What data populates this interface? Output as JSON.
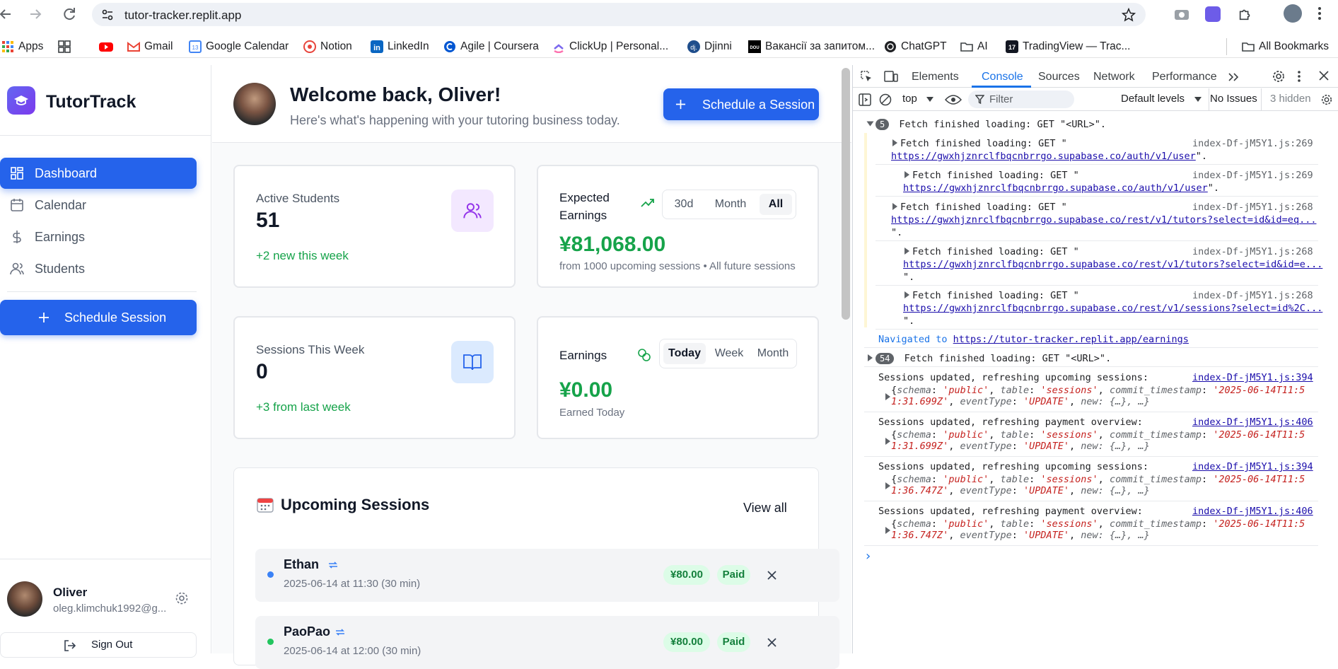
{
  "browser": {
    "url": "tutor-tracker.replit.app",
    "bookmarks": [
      {
        "label": "Apps",
        "icon": "apps-grid-icon"
      },
      {
        "label": "",
        "icon": "tab-groups-icon"
      },
      {
        "label": "",
        "icon": "youtube-icon"
      },
      {
        "label": "Gmail",
        "icon": "gmail-icon"
      },
      {
        "label": "Google Calendar",
        "icon": "google-calendar-icon"
      },
      {
        "label": "Notion",
        "icon": "notion-icon"
      },
      {
        "label": "LinkedIn",
        "icon": "linkedin-icon"
      },
      {
        "label": "Agile | Coursera",
        "icon": "coursera-icon"
      },
      {
        "label": "ClickUp | Personal...",
        "icon": "clickup-icon"
      },
      {
        "label": "Djinni",
        "icon": "djinni-icon"
      },
      {
        "label": "Вакансії за запитом...",
        "icon": "dou-icon"
      },
      {
        "label": "ChatGPT",
        "icon": "chatgpt-icon"
      },
      {
        "label": "AI",
        "icon": "folder-icon"
      },
      {
        "label": "TradingView — Trac...",
        "icon": "tradingview-icon"
      }
    ],
    "all_bookmarks": "All Bookmarks"
  },
  "sidebar": {
    "app_name": "TutorTrack",
    "nav": [
      {
        "label": "Dashboard",
        "icon": "dashboard-icon",
        "active": true
      },
      {
        "label": "Calendar",
        "icon": "calendar-icon",
        "active": false
      },
      {
        "label": "Earnings",
        "icon": "dollar-icon",
        "active": false
      },
      {
        "label": "Students",
        "icon": "users-icon",
        "active": false
      }
    ],
    "schedule_button": "Schedule Session",
    "user": {
      "name": "Oliver",
      "email": "oleg.klimchuk1992@g..."
    },
    "sign_out": "Sign Out"
  },
  "header": {
    "welcome": "Welcome back, Oliver!",
    "subtitle": "Here's what's happening with your tutoring business today.",
    "schedule_button": "Schedule a Session"
  },
  "stats": {
    "active_students": {
      "label": "Active Students",
      "value": "51",
      "delta": "+2 new this week"
    },
    "expected_earnings": {
      "label": "Expected Earnings",
      "value": "¥81,068.00",
      "note": "from 1000 upcoming sessions • All future sessions",
      "ranges": [
        "30d",
        "Month",
        "All"
      ],
      "selected": "All"
    },
    "sessions_week": {
      "label": "Sessions This Week",
      "value": "0",
      "delta": "+3 from last week"
    },
    "earnings": {
      "label": "Earnings",
      "value": "¥0.00",
      "note": "Earned Today",
      "ranges": [
        "Today",
        "Week",
        "Month"
      ],
      "selected": "Today"
    }
  },
  "upcoming": {
    "title": "Upcoming Sessions",
    "view_all": "View all",
    "sessions": [
      {
        "name": "Ethan",
        "time": "2025-06-14 at 11:30 (30 min)",
        "price": "¥80.00",
        "status": "Paid",
        "dot_color": "#3b82f6"
      },
      {
        "name": "PaoPao",
        "time": "2025-06-14 at 12:00 (30 min)",
        "price": "¥80.00",
        "status": "Paid",
        "dot_color": "#22c55e"
      }
    ]
  },
  "devtools": {
    "tabs": [
      "Elements",
      "Console",
      "Sources",
      "Network",
      "Performance"
    ],
    "selected_tab": "Console",
    "context": "top",
    "filter_placeholder": "Filter",
    "levels": "Default levels",
    "issues": "No Issues",
    "hidden": "3 hidden",
    "group_count_1": "5",
    "group_msg_1": "Fetch finished loading: GET \"<URL>\".",
    "fetch_entries": [
      {
        "msg": "Fetch finished loading: GET \"",
        "url": "https://gwxhjznrclfbqcnbrrgo.supabase.co/auth/v1/user",
        "tail": "\".",
        "src": "index-Df-jM5Y1.js:269"
      },
      {
        "msg": "Fetch finished loading: GET \"",
        "url": "https://gwxhjznrclfbqcnbrrgo.supabase.co/auth/v1/user",
        "tail": "\".",
        "src": "index-Df-jM5Y1.js:269"
      },
      {
        "msg": "Fetch finished loading: GET \"",
        "url": "https://gwxhjznrclfbqcnbrrgo.supabase.co/rest/v1/tutors?select=id&id=eq...",
        "tail": "\".",
        "src": "index-Df-jM5Y1.js:268"
      },
      {
        "msg": "Fetch finished loading: GET \"",
        "url": "https://gwxhjznrclfbqcnbrrgo.supabase.co/rest/v1/tutors?select=id&id=e...",
        "tail": "\".",
        "src": "index-Df-jM5Y1.js:268"
      },
      {
        "msg": "Fetch finished loading: GET \"",
        "url": "https://gwxhjznrclfbqcnbrrgo.supabase.co/rest/v1/sessions?select=id%2C...",
        "tail": "\".",
        "src": "index-Df-jM5Y1.js:268"
      }
    ],
    "navigated_prefix": "Navigated to ",
    "navigated_url": "https://tutor-tracker.replit.app/earnings",
    "group_count_2": "54",
    "group_msg_2": "Fetch finished loading: GET \"<URL>\".",
    "updates": [
      {
        "msg": "Sessions updated, refreshing upcoming sessions:",
        "src": "index-Df-jM5Y1.js:394",
        "ts1": "'2025-06-14T11:5",
        "ts2": "1:31.699Z'"
      },
      {
        "msg": "Sessions updated, refreshing payment overview:",
        "src": "index-Df-jM5Y1.js:406",
        "ts1": "'2025-06-14T11:5",
        "ts2": "1:31.699Z'"
      },
      {
        "msg": "Sessions updated, refreshing upcoming sessions:",
        "src": "index-Df-jM5Y1.js:394",
        "ts1": "'2025-06-14T11:5",
        "ts2": "1:36.747Z'"
      },
      {
        "msg": "Sessions updated, refreshing payment overview:",
        "src": "index-Df-jM5Y1.js:406",
        "ts1": "'2025-06-14T11:5",
        "ts2": "1:36.747Z'"
      }
    ],
    "obj_schema_key": "schema",
    "obj_schema_val": "'public'",
    "obj_table_key": "table",
    "obj_table_val": "'sessions'",
    "obj_commit_key": "commit_timestamp",
    "obj_event_key": "eventType",
    "obj_event_val": "'UPDATE'",
    "obj_new": "new: {…}, …}",
    "prompt": "›"
  }
}
